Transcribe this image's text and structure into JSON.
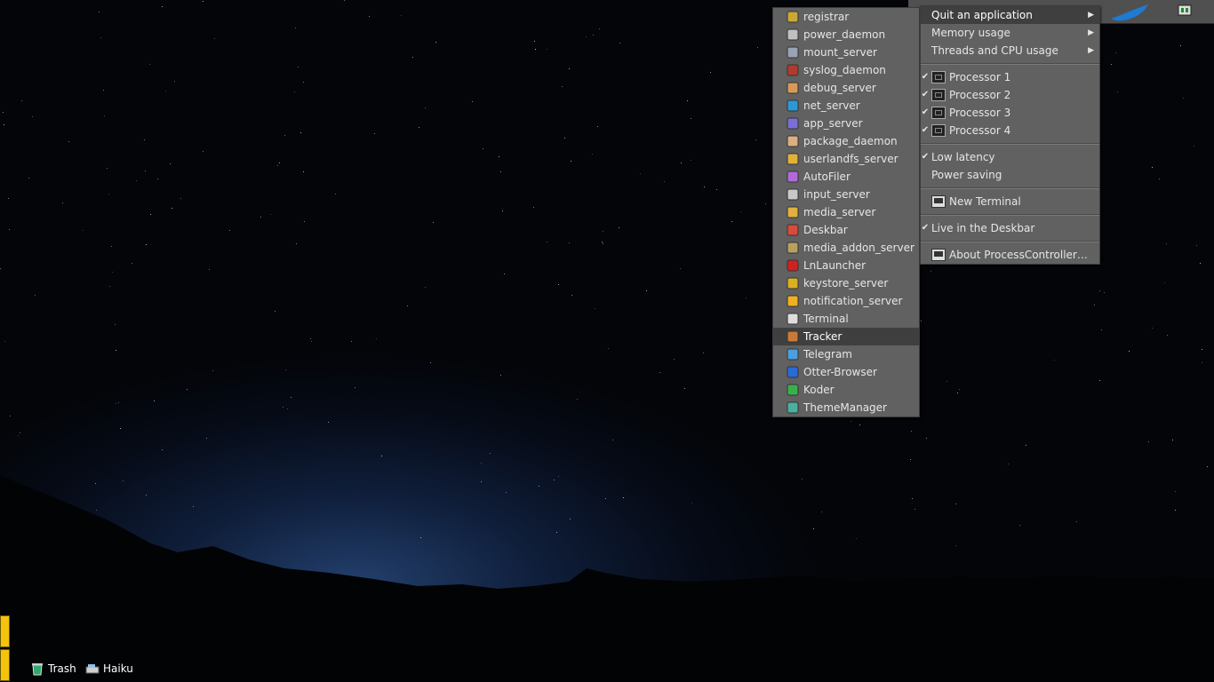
{
  "desktop": {
    "icons": [
      {
        "label": "Trash",
        "icon": "trash-icon"
      },
      {
        "label": "Haiku",
        "icon": "drive-icon"
      }
    ]
  },
  "deskbar": {
    "leaf_icon": "haiku-leaf-icon",
    "tray_icon": "process-controller-icon"
  },
  "main_menu": {
    "items": [
      {
        "label": "Quit an application",
        "submenu": true,
        "checked": false,
        "selected": true
      },
      {
        "label": "Memory usage",
        "submenu": true,
        "checked": false
      },
      {
        "label": "Threads and CPU usage",
        "submenu": true,
        "checked": false
      },
      {
        "label": "Processor 1",
        "checked": true,
        "icon": "cpu-icon"
      },
      {
        "label": "Processor 2",
        "checked": true,
        "icon": "cpu-icon"
      },
      {
        "label": "Processor 3",
        "checked": true,
        "icon": "cpu-icon"
      },
      {
        "label": "Processor 4",
        "checked": true,
        "icon": "cpu-icon"
      },
      {
        "label": "Low latency",
        "checked": true
      },
      {
        "label": "Power saving",
        "checked": false
      },
      {
        "label": "New Terminal",
        "checked": false,
        "icon": "terminal-icon"
      },
      {
        "label": "Live in the Deskbar",
        "checked": true
      },
      {
        "label": "About ProcessController…",
        "checked": false,
        "icon": "about-icon"
      }
    ],
    "check_glyph": "✔",
    "arrow_glyph": "▶"
  },
  "app_menu": {
    "items": [
      {
        "label": "registrar",
        "icon": "registrar-icon"
      },
      {
        "label": "power_daemon",
        "icon": "power-plug-icon"
      },
      {
        "label": "mount_server",
        "icon": "mount-drive-icon"
      },
      {
        "label": "syslog_daemon",
        "icon": "syslog-icon"
      },
      {
        "label": "debug_server",
        "icon": "debug-icon"
      },
      {
        "label": "net_server",
        "icon": "network-globe-icon"
      },
      {
        "label": "app_server",
        "icon": "app-server-icon"
      },
      {
        "label": "package_daemon",
        "icon": "package-icon"
      },
      {
        "label": "userlandfs_server",
        "icon": "userlandfs-icon"
      },
      {
        "label": "AutoFiler",
        "icon": "autofiler-icon"
      },
      {
        "label": "input_server",
        "icon": "input-icon"
      },
      {
        "label": "media_server",
        "icon": "media-box-icon"
      },
      {
        "label": "Deskbar",
        "icon": "deskbar-icon"
      },
      {
        "label": "media_addon_server",
        "icon": "media-addon-icon"
      },
      {
        "label": "LnLauncher",
        "icon": "launcher-icon"
      },
      {
        "label": "keystore_server",
        "icon": "keystore-lock-icon"
      },
      {
        "label": "notification_server",
        "icon": "notification-icon"
      },
      {
        "label": "Terminal",
        "icon": "terminal-icon"
      },
      {
        "label": "Tracker",
        "icon": "tracker-icon",
        "selected": true
      },
      {
        "label": "Telegram",
        "icon": "telegram-icon"
      },
      {
        "label": "Otter-Browser",
        "icon": "browser-icon"
      },
      {
        "label": "Koder",
        "icon": "koder-icon"
      },
      {
        "label": "ThemeManager",
        "icon": "theme-manager-icon"
      }
    ]
  },
  "colors": {
    "menu_bg": "#616161",
    "menu_text": "#e6e6e6",
    "menu_selected": "#3f3f3f",
    "yellow_tab": "#f2c40d"
  }
}
